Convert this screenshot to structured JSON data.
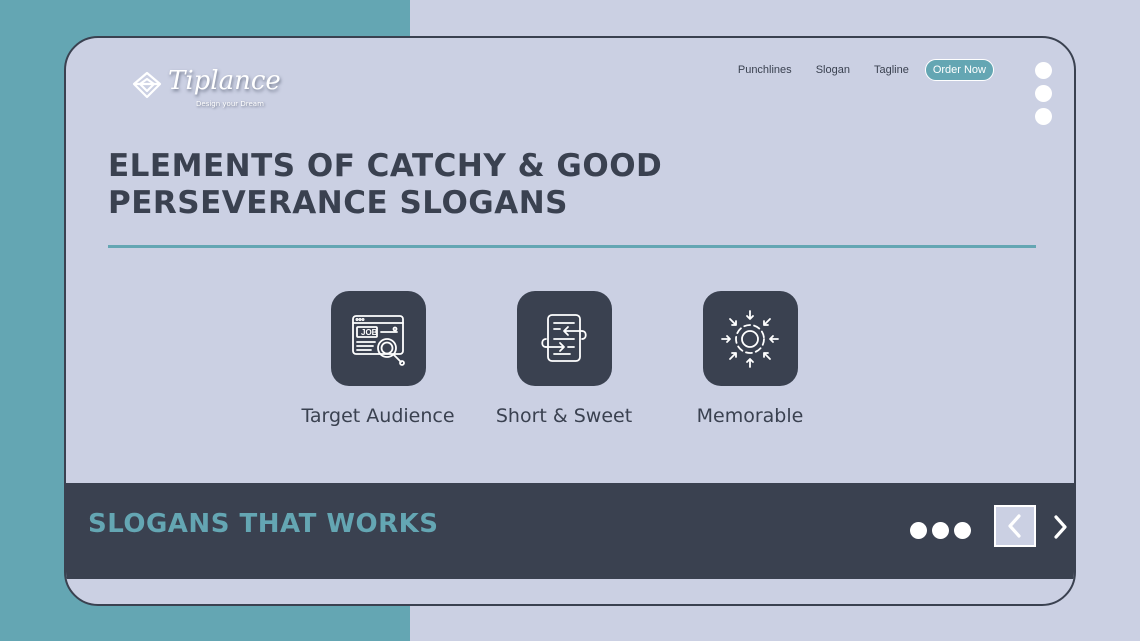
{
  "brand": {
    "name": "Tiplance",
    "tagline": "Design your Dream",
    "icon": "logo-mark-icon"
  },
  "nav": {
    "items": [
      {
        "label": "Punchlines"
      },
      {
        "label": "Slogan"
      },
      {
        "label": "Tagline"
      }
    ],
    "cta_label": "Order Now"
  },
  "menu_icon": "vertical-dots-icon",
  "main": {
    "title_line1": "ELEMENTS OF CATCHY & GOOD",
    "title_line2": "PERSEVERANCE SLOGANS",
    "features": [
      {
        "label": "Target Audience",
        "icon": "job-search-icon"
      },
      {
        "label": "Short & Sweet",
        "icon": "document-arrows-icon"
      },
      {
        "label": "Memorable",
        "icon": "focus-target-icon"
      }
    ]
  },
  "footer": {
    "title": "SLOGANS THAT WORKS",
    "prev_icon": "chevron-left-icon",
    "next_icon": "chevron-right-icon"
  },
  "colors": {
    "teal": "#64a6b3",
    "lavender": "#cbd0e3",
    "dark": "#3a4150",
    "white": "#ffffff"
  }
}
